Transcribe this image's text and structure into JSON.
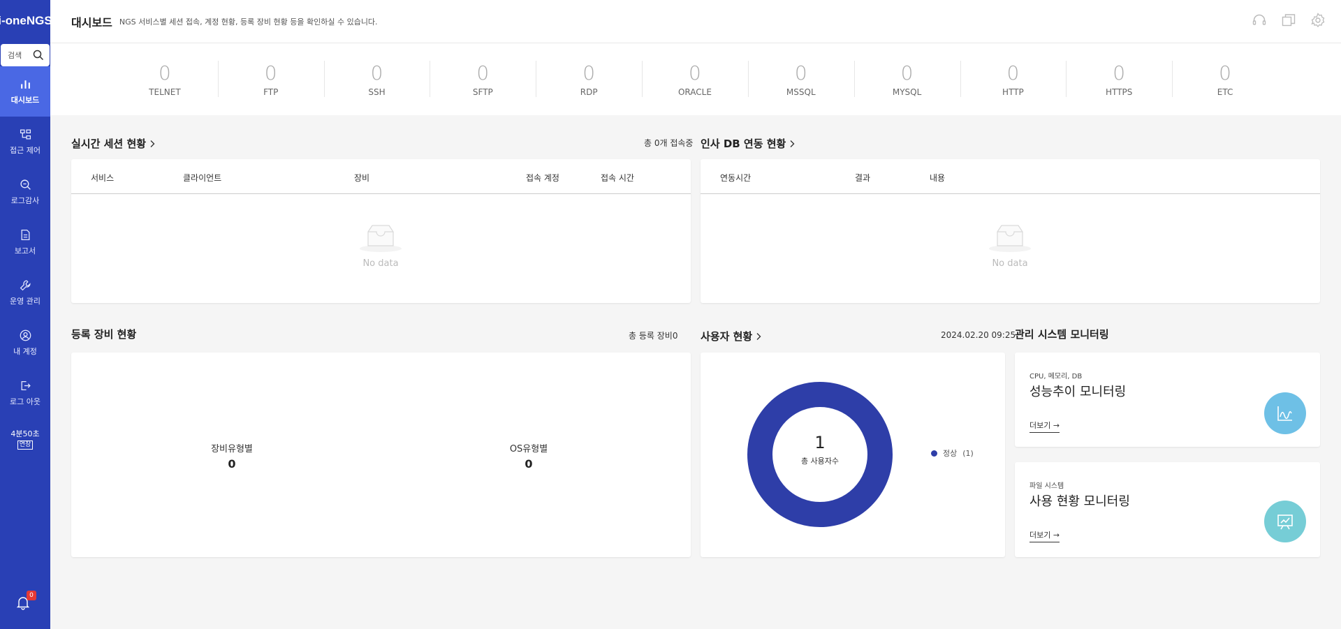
{
  "app": {
    "logo": "i-oneNGS"
  },
  "sidebar": {
    "search_label": "검색",
    "items": [
      {
        "label": "대시보드",
        "icon": "bar-chart-icon",
        "active": true
      },
      {
        "label": "접근 제어",
        "icon": "access-control-icon"
      },
      {
        "label": "로그감사",
        "icon": "search-log-icon"
      },
      {
        "label": "보고서",
        "icon": "report-icon"
      },
      {
        "label": "운영 관리",
        "icon": "wrench-icon"
      },
      {
        "label": "내 계정",
        "icon": "user-icon"
      },
      {
        "label": "로그 아웃",
        "icon": "logout-icon"
      }
    ],
    "timer": "4분50초",
    "timer_extend": "연장",
    "notification_count": "0"
  },
  "header": {
    "title": "대시보드",
    "description": "NGS 서비스별 세션 접속, 계정 현황, 등록 장비 현황 등을 확인하실 수 있습니다."
  },
  "stats": [
    {
      "label": "TELNET",
      "value": "0"
    },
    {
      "label": "FTP",
      "value": "0"
    },
    {
      "label": "SSH",
      "value": "0"
    },
    {
      "label": "SFTP",
      "value": "0"
    },
    {
      "label": "RDP",
      "value": "0"
    },
    {
      "label": "ORACLE",
      "value": "0"
    },
    {
      "label": "MSSQL",
      "value": "0"
    },
    {
      "label": "MYSQL",
      "value": "0"
    },
    {
      "label": "HTTP",
      "value": "0"
    },
    {
      "label": "HTTPS",
      "value": "0"
    },
    {
      "label": "ETC",
      "value": "0"
    }
  ],
  "realtime_sessions": {
    "title": "실시간 세션 현황",
    "summary": "총 0개 접속중",
    "columns": [
      "서비스",
      "클라이언트",
      "장비",
      "접속 계정",
      "접속 시간"
    ],
    "empty": "No data"
  },
  "hr_db": {
    "title": "인사 DB 연동 현황",
    "columns": [
      "연동시간",
      "결과",
      "내용"
    ],
    "empty": "No data"
  },
  "equipment": {
    "title": "등록 장비 현황",
    "summary": "총 등록 장비0",
    "by_type_label": "장비유형별",
    "by_type_value": "0",
    "by_os_label": "OS유형별",
    "by_os_value": "0"
  },
  "users": {
    "title": "사용자 현황",
    "timestamp": "2024.02.20 09:25",
    "total": "1",
    "total_label": "총 사용자수",
    "legend_label": "정상",
    "legend_count": "(1)",
    "color": "#2e3ea8"
  },
  "monitoring": {
    "title": "관리 시스템 모니터링",
    "cards": [
      {
        "subtitle": "CPU, 메모리, DB",
        "title": "성능추이 모니터링",
        "more": "더보기 →",
        "color": "#6ec0e6"
      },
      {
        "subtitle": "파일 시스템",
        "title": "사용 현황 모니터링",
        "more": "더보기 →",
        "color": "#76cdd6"
      }
    ]
  }
}
